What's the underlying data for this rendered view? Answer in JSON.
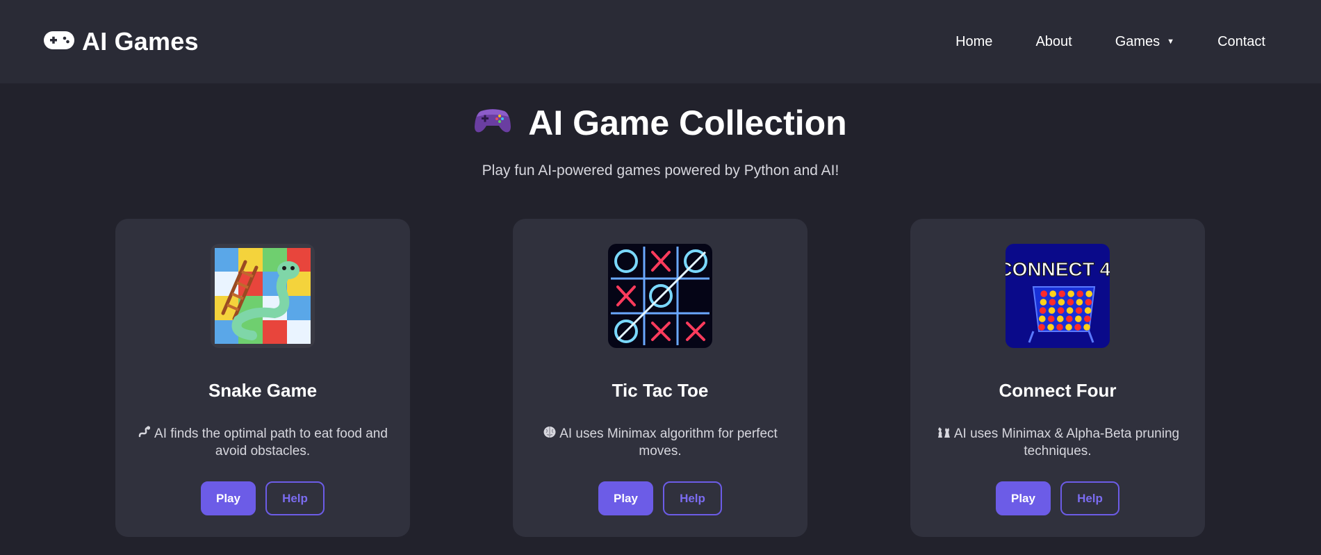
{
  "nav": {
    "brand_icon": "gamepad-icon",
    "brand_title": "AI Games",
    "links": [
      {
        "label": "Home"
      },
      {
        "label": "About"
      },
      {
        "label": "Games",
        "has_dropdown": true
      },
      {
        "label": "Contact"
      }
    ]
  },
  "hero": {
    "icon": "controller-emoji-icon",
    "title": "AI Game Collection",
    "subtitle": "Play fun AI-powered games powered by Python and AI!"
  },
  "games": [
    {
      "title": "Snake Game",
      "thumb": "snakes-and-ladders-thumbnail",
      "desc_icon": "snake-icon",
      "description": "AI finds the optimal path to eat food and avoid obstacles.",
      "play_label": "Play",
      "help_label": "Help"
    },
    {
      "title": "Tic Tac Toe",
      "thumb": "neon-tic-tac-toe-thumbnail",
      "desc_icon": "brain-icon",
      "description": "AI uses Minimax algorithm for perfect moves.",
      "play_label": "Play",
      "help_label": "Help"
    },
    {
      "title": "Connect Four",
      "thumb": "connect-four-thumbnail",
      "thumb_text": "CONNECT 4!",
      "desc_icon": "chess-pieces-icon",
      "description": "AI uses Minimax & Alpha-Beta pruning techniques.",
      "play_label": "Play",
      "help_label": "Help"
    }
  ],
  "colors": {
    "background": "#22222c",
    "navbar": "#2a2b36",
    "card": "#30313d",
    "accent": "#6c5ce7",
    "text": "#ffffff",
    "muted_text": "#d7d7de"
  }
}
